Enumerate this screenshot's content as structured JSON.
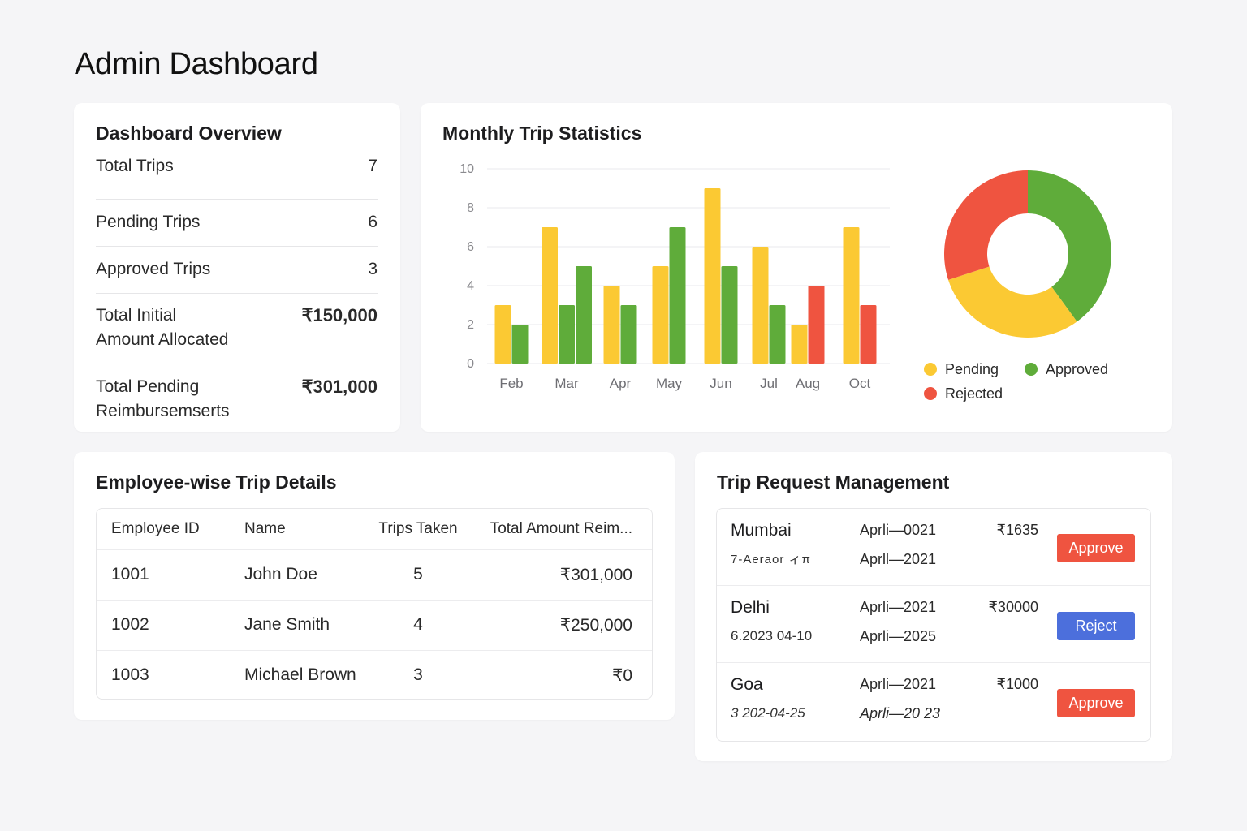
{
  "page": {
    "title": "Admin Dashboard"
  },
  "colors": {
    "pending": "#fbc933",
    "approved": "#5fac3a",
    "rejected": "#ef5440",
    "reject_button": "#4c6fdc"
  },
  "overview": {
    "title": "Dashboard Overview",
    "rows": [
      {
        "label": "Total Trips",
        "value": "7"
      },
      {
        "label": "Pending Trips",
        "value": "6"
      },
      {
        "label": "Approved Trips",
        "value": "3"
      },
      {
        "label": "Total Initial Amount Allocated",
        "label_line1": "Total Initial",
        "label_line2": "Amount Allocated",
        "value": "₹150,000"
      },
      {
        "label": "Total Pending Reimbursemserts",
        "label_line1": "Total Pending",
        "label_line2": "Reimbursemserts",
        "value": "₹301,000"
      }
    ]
  },
  "stats": {
    "title": "Monthly Trip Statistics",
    "legend": [
      {
        "label": "Pending",
        "color": "#fbc933"
      },
      {
        "label": "Approved",
        "color": "#5fac3a"
      },
      {
        "label": "Rejected",
        "color": "#ef5440"
      }
    ]
  },
  "chart_data": [
    {
      "type": "bar",
      "title": "",
      "xlabel": "",
      "ylabel": "",
      "ylim": [
        0,
        10
      ],
      "yticks": [
        0,
        2,
        4,
        6,
        8,
        10
      ],
      "grid": true,
      "categories": [
        "Feb",
        "Mar",
        "Apr",
        "May",
        "Jun",
        "Jul",
        "Aug",
        "Oct"
      ],
      "bars": [
        {
          "category": "Feb",
          "series": "Pending",
          "value": 3
        },
        {
          "category": "Feb",
          "series": "Approved",
          "value": 2
        },
        {
          "category": "Mar",
          "series": "Pending",
          "value": 7
        },
        {
          "category": "Mar",
          "series": "Approved",
          "value": 3
        },
        {
          "category": "Mar",
          "series": "Approved",
          "value": 5
        },
        {
          "category": "Apr",
          "series": "Pending",
          "value": 4
        },
        {
          "category": "Apr",
          "series": "Approved",
          "value": 3
        },
        {
          "category": "May",
          "series": "Pending",
          "value": 5
        },
        {
          "category": "May",
          "series": "Approved",
          "value": 7
        },
        {
          "category": "Jun",
          "series": "Pending",
          "value": 9
        },
        {
          "category": "Jun",
          "series": "Approved",
          "value": 5
        },
        {
          "category": "Jul",
          "series": "Pending",
          "value": 6
        },
        {
          "category": "Jul",
          "series": "Approved",
          "value": 3
        },
        {
          "category": "Aug",
          "series": "Pending",
          "value": 2
        },
        {
          "category": "Aug",
          "series": "Rejected",
          "value": 4
        },
        {
          "category": "Oct",
          "series": "Pending",
          "value": 7
        },
        {
          "category": "Oct",
          "series": "Rejected",
          "value": 3
        }
      ]
    },
    {
      "type": "pie",
      "donut": true,
      "labels": [
        "Approved",
        "Pending",
        "Rejected"
      ],
      "values": [
        40,
        30,
        30
      ],
      "colors": [
        "#5fac3a",
        "#fbc933",
        "#ef5440"
      ],
      "legend_position": "bottom"
    }
  ],
  "employees": {
    "title": "Employee-wise Trip Details",
    "columns": [
      "Employee ID",
      "Name",
      "Trips Taken",
      "Total Amount Reim..."
    ],
    "rows": [
      {
        "id": "1001",
        "name": "John Doe",
        "trips": "5",
        "amount": "₹301,000"
      },
      {
        "id": "1002",
        "name": "Jane Smith",
        "trips": "4",
        "amount": "₹250,000"
      },
      {
        "id": "1003",
        "name": "Michael Brown",
        "trips": "3",
        "amount": "₹0"
      }
    ]
  },
  "requests": {
    "title": "Trip Request Management",
    "rows": [
      {
        "city": "Mumbai",
        "sub": "7-Aeraor ィπ",
        "date1": "Aprli—0021",
        "date2": "Aprll—2021",
        "amount": "₹1635",
        "action": "Approve",
        "action_type": "approve"
      },
      {
        "city": "Delhi",
        "sub": "6.2023 04-10",
        "date1": "Aprli—2021",
        "date2": "Aprli—2025",
        "amount": "₹30000",
        "action": "Reject",
        "action_type": "reject"
      },
      {
        "city": "Goa",
        "sub": "3 202-04-25",
        "date1": "Aprli—2021",
        "date2": "Aprli—20 23",
        "amount": "₹1000",
        "action": "Approve",
        "action_type": "approve"
      }
    ]
  }
}
